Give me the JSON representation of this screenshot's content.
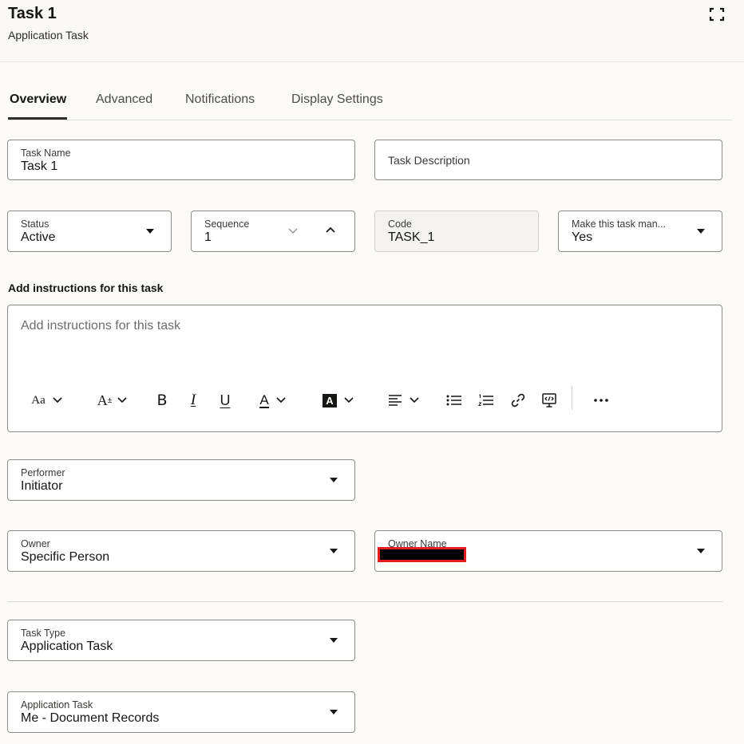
{
  "header": {
    "title": "Task 1",
    "subtitle": "Application Task",
    "expand_icon": "expand-icon"
  },
  "tabs": [
    {
      "label": "Overview",
      "active": true
    },
    {
      "label": "Advanced",
      "active": false
    },
    {
      "label": "Notifications",
      "active": false
    },
    {
      "label": "Display Settings",
      "active": false
    }
  ],
  "fields": {
    "task_name": {
      "label": "Task Name",
      "value": "Task 1"
    },
    "task_description": {
      "placeholder": "Task Description"
    },
    "status": {
      "label": "Status",
      "value": "Active"
    },
    "sequence": {
      "label": "Sequence",
      "value": "1"
    },
    "code": {
      "label": "Code",
      "value": "TASK_1"
    },
    "mandatory": {
      "label": "Make this task man...",
      "value": "Yes"
    },
    "performer": {
      "label": "Performer",
      "value": "Initiator"
    },
    "owner": {
      "label": "Owner",
      "value": "Specific Person"
    },
    "owner_name": {
      "label": "Owner Name",
      "value_redacted": true
    },
    "task_type": {
      "label": "Task Type",
      "value": "Application Task"
    },
    "application_task": {
      "label": "Application Task",
      "value": "Me - Document Records"
    }
  },
  "instructions": {
    "section_label": "Add instructions for this task",
    "placeholder": "Add instructions for this task",
    "toolbar": [
      "font-family-icon",
      "font-size-icon",
      "bold-icon",
      "italic-icon",
      "underline-icon",
      "font-color-icon",
      "highlight-color-icon",
      "align-icon",
      "bullet-list-icon",
      "numbered-list-icon",
      "link-icon",
      "embed-media-icon",
      "more-icon"
    ],
    "toolbar_glyphs": {
      "font_family": "Aa",
      "font_size": "A",
      "bold": "B",
      "italic": "I",
      "underline": "U",
      "font_color": "A",
      "highlight": "A"
    }
  },
  "colors": {
    "accent_tab": "#312d2a",
    "redaction": "#e41e1e",
    "field_border": "#8d8a86",
    "background": "#fbfaf9"
  }
}
